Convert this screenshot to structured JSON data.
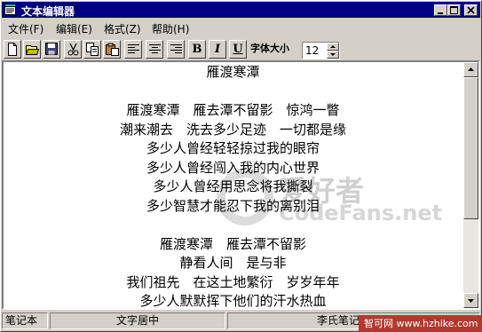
{
  "window": {
    "title": "文本编辑器"
  },
  "menubar": {
    "items": [
      {
        "label": "文件(F)"
      },
      {
        "label": "编辑(E)"
      },
      {
        "label": "格式(Z)"
      },
      {
        "label": "帮助(H)"
      }
    ]
  },
  "toolbar": {
    "buttons": [
      {
        "icon": "new-file-icon"
      },
      {
        "icon": "open-folder-icon"
      },
      {
        "icon": "save-disk-icon"
      },
      {
        "icon": "cut-scissors-icon"
      },
      {
        "icon": "copy-icon"
      },
      {
        "icon": "paste-icon"
      },
      {
        "icon": "align-left-icon"
      },
      {
        "icon": "align-center-icon"
      },
      {
        "icon": "align-right-icon"
      }
    ],
    "bold_label": "B",
    "italic_label": "I",
    "underline_label": "U",
    "font_size_label": "字体大小",
    "font_size_value": "12"
  },
  "editor": {
    "lines": [
      "雁渡寒潭",
      "",
      "雁渡寒潭　雁去潭不留影　惊鸿一瞥",
      "潮来潮去　洗去多少足迹　一切都是缘",
      "多少人曾经轻轻掠过我的眼帘",
      "多少人曾经闯入我的内心世界",
      "多少人曾经用思念将我撕裂",
      "多少智慧才能忍下我的离别泪",
      "",
      "雁渡寒潭　雁去潭不留影",
      "静看人间　是与非",
      "我们祖先　在这土地繁衍　岁岁年年",
      "多少人默默挥下他们的汗水热血"
    ]
  },
  "watermark": {
    "cn": "爱好者",
    "en": "CodeFans.net"
  },
  "statusbar": {
    "panels": [
      {
        "label": "笔记本"
      },
      {
        "label": "文字居中"
      },
      {
        "label": "李氏笔记"
      }
    ]
  },
  "site_band": {
    "text": "智可网 www.hzhike.com"
  }
}
